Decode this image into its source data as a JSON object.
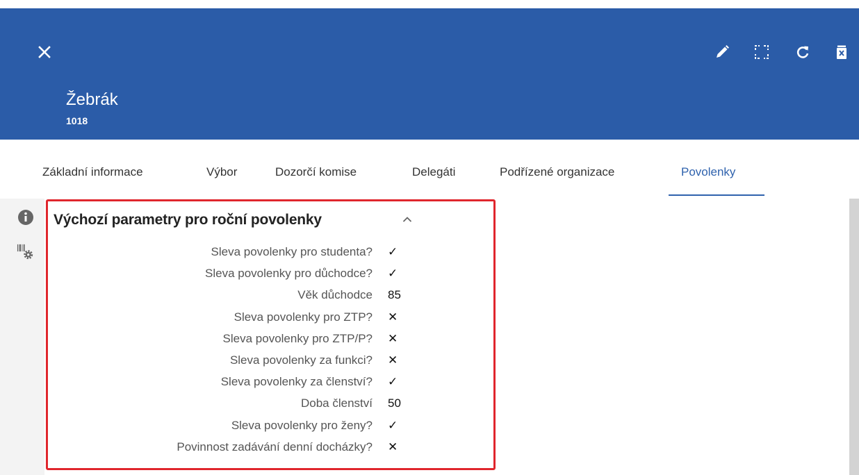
{
  "header": {
    "title": "Žebrák",
    "subtitle": "1018",
    "close_icon": "close-icon",
    "tools": [
      "edit-icon",
      "fullscreen-icon",
      "refresh-icon",
      "delete-icon"
    ]
  },
  "tabs": [
    {
      "label": "Základní informace",
      "active": false
    },
    {
      "label": "Výbor",
      "active": false
    },
    {
      "label": "Dozorčí komise",
      "active": false
    },
    {
      "label": "Delegáti",
      "active": false
    },
    {
      "label": "Podřízené organizace",
      "active": false
    },
    {
      "label": "Povolenky",
      "active": true
    }
  ],
  "sidebar": {
    "icons": [
      "info-icon",
      "barcode-settings-icon"
    ]
  },
  "section": {
    "title": "Výchozí parametry pro roční povolenky",
    "rows": [
      {
        "label": "Sleva povolenky pro studenta?",
        "value": "✓"
      },
      {
        "label": "Sleva povolenky pro důchodce?",
        "value": "✓"
      },
      {
        "label": "Věk důchodce",
        "value": "85"
      },
      {
        "label": "Sleva povolenky pro ZTP?",
        "value": "✕"
      },
      {
        "label": "Sleva povolenky pro ZTP/P?",
        "value": "✕"
      },
      {
        "label": "Sleva povolenky za funkci?",
        "value": "✕"
      },
      {
        "label": "Sleva povolenky za členství?",
        "value": "✓"
      },
      {
        "label": "Doba členství",
        "value": "50"
      },
      {
        "label": "Sleva povolenky pro ženy?",
        "value": "✓"
      },
      {
        "label": "Povinnost zadávání denní docházky?",
        "value": "✕"
      }
    ]
  },
  "colors": {
    "header": "#2b5ca8",
    "accent": "#2f62ad",
    "highlight_border": "#e0262d"
  }
}
